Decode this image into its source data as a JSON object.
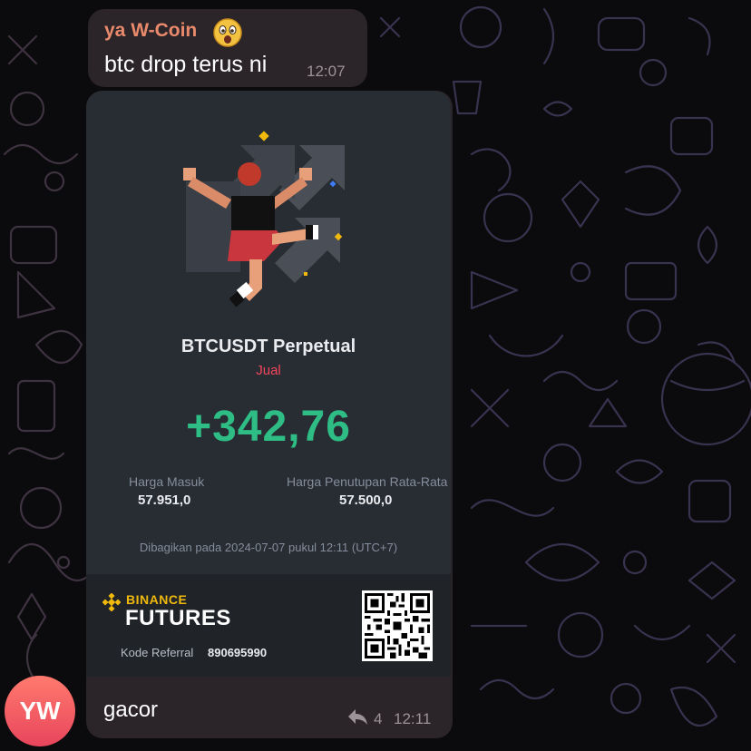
{
  "colors": {
    "background": "#0b0a0d",
    "bubble": "#2b2428",
    "sender_name": "#ea8a6d",
    "doodle_stroke": "#4a3a44",
    "card": "#282c33",
    "profit_green": "#2ebd85",
    "sell_red": "#f6465d",
    "binance_yellow": "#f0b90b",
    "avatar": "#ef5b63"
  },
  "messages": [
    {
      "sender": "ya W-Coin",
      "sender_emoji": "face-with-open-mouth-emoji",
      "text": "btc drop terus ni",
      "time": "12:07"
    },
    {
      "caption": "gacor",
      "reply_count": "4",
      "time": "12:11",
      "avatar_initials": "YW"
    }
  ],
  "trade_card": {
    "pair": "BTCUSDT Perpetual",
    "side": "Jual",
    "pnl": "+342,76",
    "entry_label": "Harga Masuk",
    "entry_value": "57.951,0",
    "close_label": "Harga Penutupan Rata-Rata",
    "close_value": "57.500,0",
    "shared_text": "Dibagikan pada 2024-07-07 pukul 12:11 (UTC+7)",
    "brand_top": "BINANCE",
    "brand_bottom": "FUTURES",
    "referral_label": "Kode Referral",
    "referral_code": "890695990"
  }
}
